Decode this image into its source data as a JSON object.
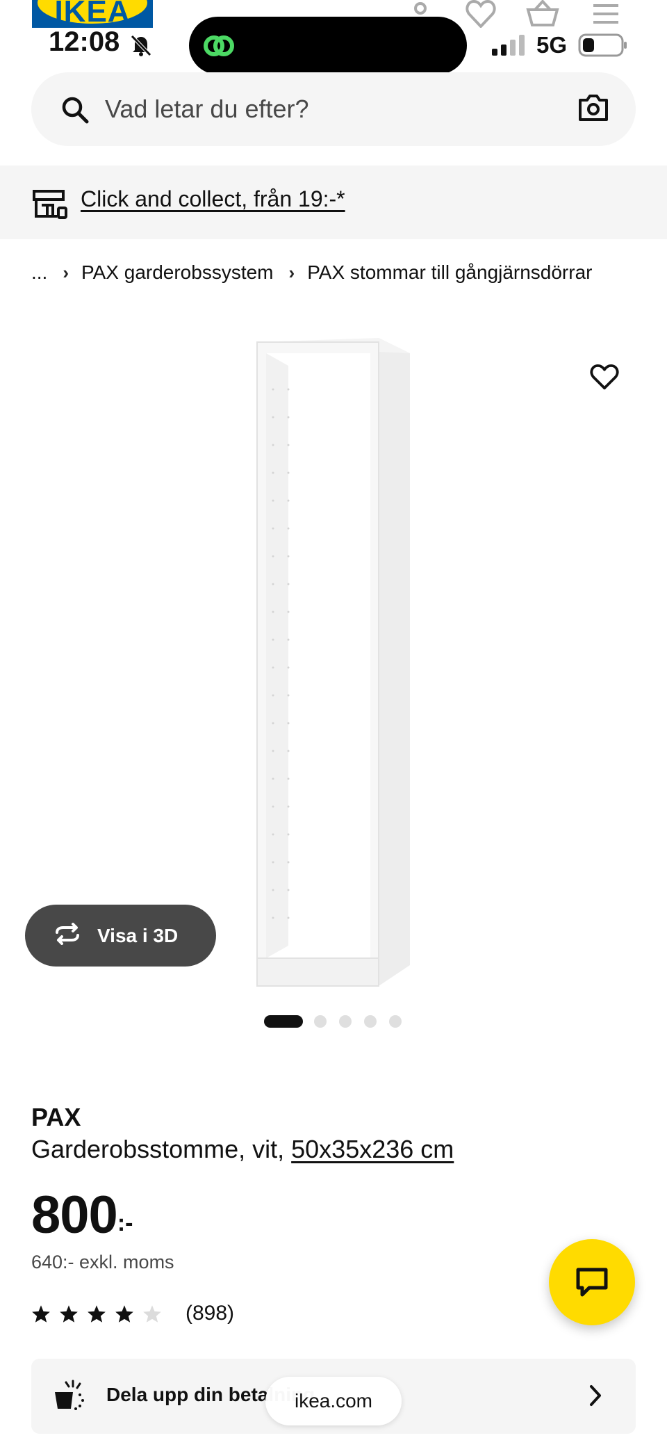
{
  "brand": {
    "logo_text": "IKEA",
    "blue": "#0058a3",
    "yellow": "#ffdb00"
  },
  "status_bar": {
    "time": "12:08",
    "network": "5G",
    "icons": [
      "bell-off-icon",
      "signal-icon",
      "battery-icon"
    ]
  },
  "header": {
    "icons": [
      "user-icon",
      "heart-icon",
      "cart-icon",
      "menu-icon"
    ]
  },
  "search": {
    "placeholder": "Vad letar du efter?",
    "value": ""
  },
  "collect": {
    "label": "Click and collect, från 19:-*"
  },
  "breadcrumb": {
    "items": [
      "...",
      "PAX garderobssystem",
      "PAX stommar till gångjärnsdörrar"
    ]
  },
  "gallery": {
    "view3d_label": "Visa i 3D",
    "slide_count": 5,
    "active_slide": 1
  },
  "product": {
    "name": "PAX",
    "description": "Garderobsstomme, vit,",
    "size": "50x35x236 cm",
    "price": "800",
    "price_suffix": ":-",
    "price_ex_vat": "640:- exkl. moms",
    "rating": 4,
    "rating_max": 5,
    "review_count": "(898)"
  },
  "payment": {
    "label": "Dela upp din betalning"
  },
  "browser": {
    "url": "ikea.com"
  }
}
